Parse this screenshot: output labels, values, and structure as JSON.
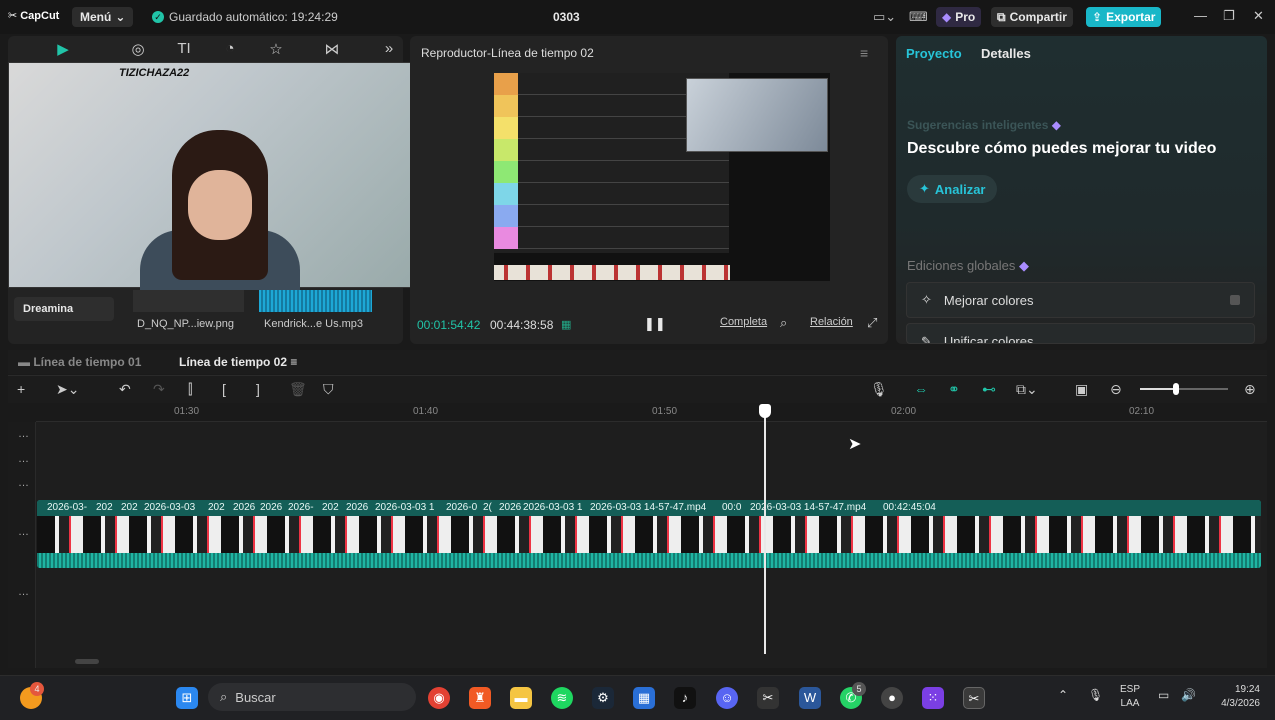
{
  "titlebar": {
    "logo": "CapCut",
    "menu": "Menú",
    "autosave": "Guardado automático: 19:24:29",
    "project": "0303",
    "pro": "Pro",
    "share": "Compartir",
    "export": "Exportar"
  },
  "media": {
    "dreamina": "Dreamina",
    "file1": "D_NQ_NP...iew.png",
    "file2": "Kendrick...e Us.mp3",
    "stream_text": "TIZICHAZA22"
  },
  "player": {
    "title": "Reproductor-Línea de tiempo 02",
    "current": "00:01:54:42",
    "total": "00:44:38:58",
    "complete": "Completa",
    "ratio": "Relación"
  },
  "props": {
    "tab_project": "Proyecto",
    "tab_details": "Detalles",
    "smart": "Sugerencias inteligentes",
    "discover": "Descubre cómo puedes mejorar tu video",
    "analyze": "Analizar",
    "global_edits": "Ediciones globales",
    "opt1": "Mejorar colores",
    "opt2": "Unificar colores"
  },
  "timeline": {
    "tab1": "Línea de tiempo 01",
    "tab2": "Línea de tiempo 02",
    "ticks": [
      "01:30",
      "01:40",
      "01:50",
      "02:00",
      "02:10"
    ],
    "clips": [
      "2026-03-",
      "202",
      "202",
      "2026-03-03",
      "202",
      "2026",
      "2026",
      "2026-",
      "202",
      "2026",
      "2026-03-03 1",
      "2026-0",
      "2(",
      "2026",
      "2026-03-03 1",
      "2026-03-03 14-57-47.mp4",
      "00:0",
      "2026-03-03 14-57-47.mp4",
      "00:42:45:04"
    ]
  },
  "taskbar": {
    "search": "Buscar",
    "lang1": "ESP",
    "lang2": "LAA",
    "time": "19:24",
    "date": "4/3/2026",
    "badge1": "4",
    "badge2": "5"
  },
  "colors": {
    "accent": "#21c4a8",
    "export": "#19b7c8",
    "clip": "#1e9e8e"
  }
}
